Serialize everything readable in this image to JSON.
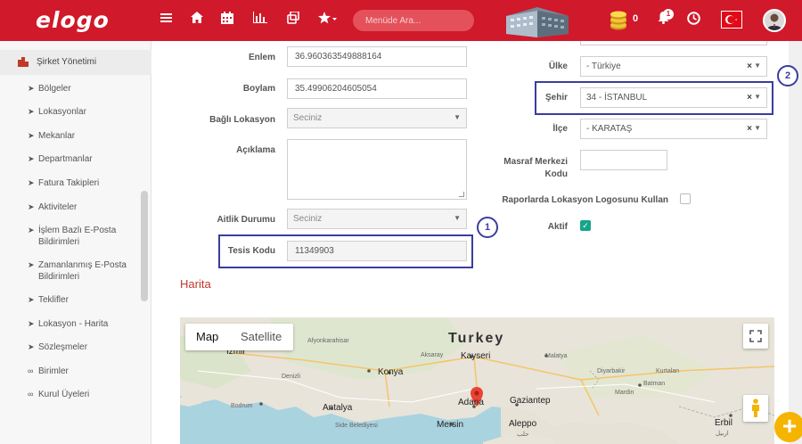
{
  "header": {
    "brand": "elogo",
    "search_placeholder": "Menüde Ara...",
    "coin_count": "0",
    "notification_count": "1",
    "accent": "#d0192a"
  },
  "sidebar": {
    "title": "Şirket Yönetimi",
    "items": [
      {
        "label": "Bölgeler",
        "icon": "arrow"
      },
      {
        "label": "Lokasyonlar",
        "icon": "arrow"
      },
      {
        "label": "Mekanlar",
        "icon": "arrow"
      },
      {
        "label": "Departmanlar",
        "icon": "arrow"
      },
      {
        "label": "Fatura Takipleri",
        "icon": "arrow"
      },
      {
        "label": "Aktiviteler",
        "icon": "arrow"
      },
      {
        "label": "İşlem Bazlı E-Posta Bildirimleri",
        "icon": "arrow"
      },
      {
        "label": "Zamanlanmış E-Posta Bildirimleri",
        "icon": "arrow"
      },
      {
        "label": "Teklifler",
        "icon": "arrow"
      },
      {
        "label": "Lokasyon - Harita",
        "icon": "arrow"
      },
      {
        "label": "Sözleşmeler",
        "icon": "arrow"
      },
      {
        "label": "Birimler",
        "icon": "link"
      },
      {
        "label": "Kurul Üyeleri",
        "icon": "link"
      }
    ]
  },
  "form": {
    "enlem_label": "Enlem",
    "enlem_value": "36.960363549888164",
    "boylam_label": "Boylam",
    "boylam_value": "35.49906204605054",
    "bagli_label": "Bağlı Lokasyon",
    "bagli_value": "Seciniz",
    "aciklama_label": "Açıklama",
    "aitlik_label": "Aitlik Durumu",
    "aitlik_value": "Seciniz",
    "tesis_label": "Tesis Kodu",
    "tesis_value": "11349903",
    "ulke_label": "Ülke",
    "ulke_value": "- Türkiye",
    "sehir_label": "Şehir",
    "sehir_value": "34 - İSTANBUL",
    "ilce_label": "İlçe",
    "ilce_value": "- KARATAŞ",
    "masraf_label_1": "Masraf Merkezi",
    "masraf_label_2": "Kodu",
    "raporlarda_label": "Raporlarda Lokasyon Logosunu Kullan",
    "raporlarda_checked": false,
    "aktif_label": "Aktif",
    "aktif_checked": true
  },
  "annotations": {
    "marker_1": "1",
    "marker_2": "2",
    "color": "#3a3d9e"
  },
  "map": {
    "section_title": "Harita",
    "type_map": "Map",
    "type_satellite": "Satellite",
    "places": {
      "country": "Turkey",
      "izmir": "İzmir",
      "afyon": "Afyonkarahisar",
      "aksaray": "Aksaray",
      "kayseri": "Kayseri",
      "malatya": "Malatya",
      "diyarbakir": "Diyarbakir",
      "kurtalan": "Kurtalan",
      "denizli": "Denizli",
      "konya": "Konya",
      "batman": "Batman",
      "mardin": "Mardin",
      "bodrum": "Bodrum",
      "antalya": "Antalya",
      "adana": "Adana",
      "gaziantep": "Gaziantep",
      "erbil_1": "Erbil",
      "erbil_2": "اربيل",
      "mersin": "Mersin",
      "aleppo_1": "Aleppo",
      "aleppo_2": "حلب",
      "side": "Side Belediyesi"
    }
  }
}
